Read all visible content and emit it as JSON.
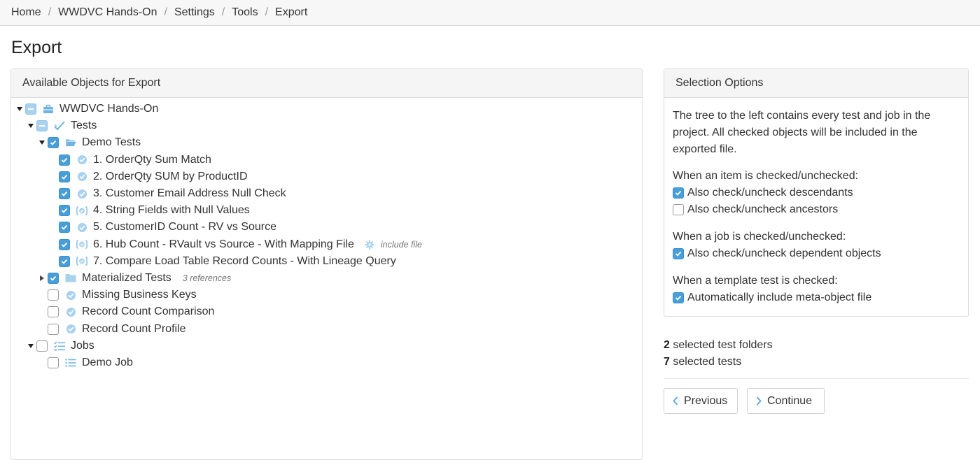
{
  "breadcrumb": {
    "items": [
      "Home",
      "WWDVC Hands-On",
      "Settings",
      "Tools",
      "Export"
    ],
    "separator": "/"
  },
  "page_title": "Export",
  "left_panel": {
    "title": "Available Objects for Export",
    "tree": {
      "root_label": "WWDVC Hands-On",
      "tests_label": "Tests",
      "demo_tests_label": "Demo Tests",
      "demo_tests": [
        "1. OrderQty Sum Match",
        "2. OrderQty SUM by ProductID",
        "3. Customer Email Address Null Check",
        "4. String Fields with Null Values",
        "5. CustomerID Count - RV vs Source",
        "6. Hub Count - RVault vs Source - With Mapping File",
        "7. Compare Load Table Record Counts - With Lineage Query"
      ],
      "include_file_label": "include file",
      "materialized_label": "Materialized Tests",
      "materialized_note": "3 references",
      "other_tests": [
        "Missing Business Keys",
        "Record Count Comparison",
        "Record Count Profile"
      ],
      "jobs_label": "Jobs",
      "jobs": [
        "Demo Job"
      ]
    }
  },
  "right_panel": {
    "title": "Selection Options",
    "description": "The tree to the left contains every test and job in the project. All checked objects will be included in the exported file.",
    "item_heading": "When an item is checked/unchecked:",
    "opt_descendants": "Also check/uncheck descendants",
    "opt_ancestors": "Also check/uncheck ancestors",
    "job_heading": "When a job is checked/unchecked:",
    "opt_dependent": "Also check/uncheck dependent objects",
    "template_heading": "When a template test is checked:",
    "opt_meta": "Automatically include meta-object file"
  },
  "counts": {
    "folders_num": "2",
    "folders_label": "selected test folders",
    "tests_num": "7",
    "tests_label": "selected tests"
  },
  "buttons": {
    "previous": "Previous",
    "continue": "Continue"
  },
  "colors": {
    "accent": "#4a9ed8",
    "icon": "#6fb3e3"
  }
}
